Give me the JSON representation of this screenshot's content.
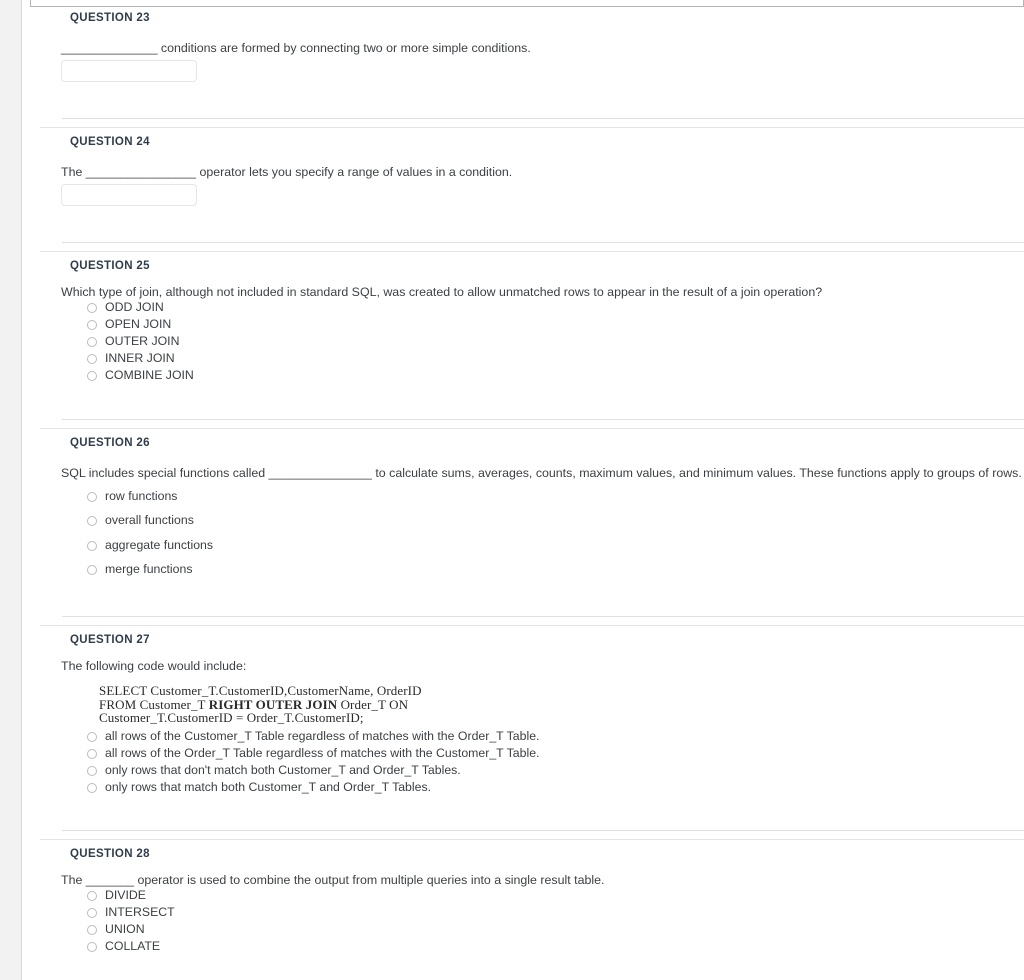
{
  "page": {
    "gutter_color": "#f2f2f2",
    "rule_color": "#e3e3e3",
    "header_color": "#2f3d4c"
  },
  "questions": [
    {
      "header": "QUESTION 23",
      "prompt": "______________  conditions are formed by connecting two or more simple conditions.",
      "type": "fill-in",
      "input_value": "",
      "input_placeholder": ""
    },
    {
      "header": "QUESTION 24",
      "prompt": "The ________________ operator lets you specify a range of values in a condition.",
      "type": "fill-in",
      "input_value": "",
      "input_placeholder": ""
    },
    {
      "header": "QUESTION 25",
      "prompt": "Which type of join, although not included in standard SQL, was created to allow unmatched rows to appear in the result of a join operation?",
      "type": "multiple-choice",
      "options": [
        "ODD JOIN",
        "OPEN JOIN",
        "OUTER JOIN",
        "INNER JOIN",
        "COMBINE JOIN"
      ]
    },
    {
      "header": "QUESTION 26",
      "prompt": "SQL includes special functions called _______________ to calculate sums, averages, counts, maximum values, and minimum values.  These functions apply to groups of rows.",
      "type": "multiple-choice",
      "options": [
        "row functions",
        "overall functions",
        "aggregate functions",
        "merge functions"
      ]
    },
    {
      "header": "QUESTION 27",
      "prompt": "The following code would include:",
      "type": "multiple-choice-with-code",
      "code": {
        "line1": "SELECT Customer_T.CustomerID,CustomerName, OrderID",
        "line2_pre": "FROM Customer_T ",
        "line2_bold": "RIGHT OUTER JOIN",
        "line2_post": " Order_T ON",
        "line3": "Customer_T.CustomerID = Order_T.CustomerID;"
      },
      "options": [
        "all rows of the Customer_T Table regardless of matches with the Order_T Table.",
        "all rows of the Order_T Table regardless of matches with the Customer_T Table.",
        "only rows that don't match both Customer_T and Order_T Tables.",
        "only rows that match both Customer_T and Order_T Tables."
      ]
    },
    {
      "header": "QUESTION 28",
      "prompt": "The _______ operator is used to combine the output from multiple queries into a single result table.",
      "type": "multiple-choice",
      "options": [
        "DIVIDE",
        "INTERSECT",
        "UNION",
        "COLLATE"
      ]
    }
  ]
}
